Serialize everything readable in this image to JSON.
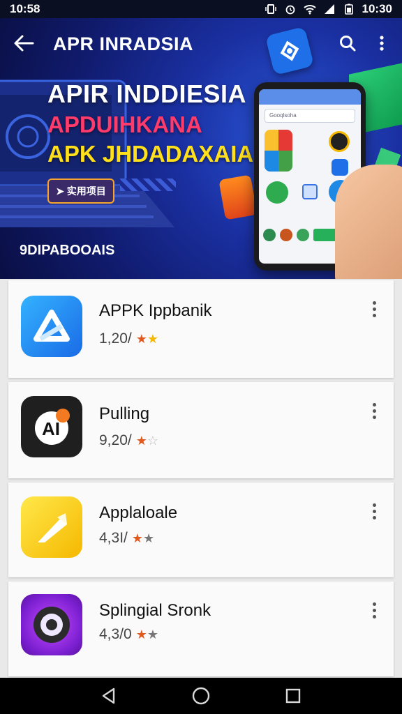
{
  "status_bar": {
    "time": "10:58",
    "clock": "10:30",
    "icons": [
      "vibrate-icon",
      "alarm-icon",
      "wifi-icon",
      "signal-icon",
      "battery-icon"
    ]
  },
  "appbar": {
    "title": "APR INRADSIA"
  },
  "banner": {
    "line1": "APIR INDDIESIA",
    "line2": "APDUIHKANA",
    "line3": "APK JHDADAXAIA",
    "cta": "➤ 实用项目",
    "tag": "9DIPABOOAIS",
    "phone_search": "Gooqlsoha"
  },
  "apps": [
    {
      "name": "APPK Ippbanik",
      "downloads": "1,20/",
      "stars": "★★",
      "star_colors": [
        "#e05a1e",
        "#f5b800"
      ],
      "icon": "app-icon-blue-chevron"
    },
    {
      "name": "Pulling",
      "downloads": "9,20/",
      "stars": "★☆",
      "star_colors": [
        "#e05a1e",
        "#bbbbbb"
      ],
      "icon": "app-icon-ai-badge"
    },
    {
      "name": "Applaloale",
      "downloads": "4,3I/",
      "stars": "★★",
      "star_colors": [
        "#e05a1e",
        "#777777"
      ],
      "icon": "app-icon-yellow-arrow"
    },
    {
      "name": "Splingial Sronk",
      "downloads": "4,3/0",
      "stars": "★★",
      "star_colors": [
        "#e05a1e",
        "#777777"
      ],
      "icon": "app-icon-purple-gear"
    }
  ],
  "colors": {
    "banner_bg": "#1a2fa0",
    "accent_red": "#ff3b6b",
    "accent_yellow": "#ffe01a",
    "card_bg": "#fafafa"
  }
}
